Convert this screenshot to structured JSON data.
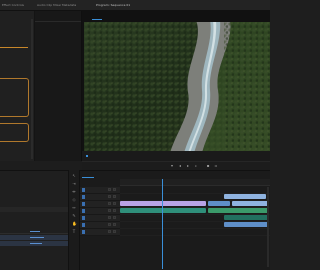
{
  "menubar": {
    "tabs": [
      "Effect Controls",
      "Audio Clip Mixer",
      "Metadata",
      "Program: Sequence 01"
    ]
  },
  "effect_controls": {
    "title": "Effect Controls"
  },
  "source_monitor": {
    "title": "Audio Clip Mixer"
  },
  "program_monitor": {
    "title": "Program: Sequence 01",
    "timecode": "00:00:05:00"
  },
  "transport": {
    "controls": [
      "marker-icon",
      "step-back-icon",
      "play-icon",
      "step-forward-icon",
      "insert-icon",
      "export-frame-icon"
    ]
  },
  "project_panel": {
    "title": "Project: Untitled",
    "columns": [
      "Name",
      "Frame Rate",
      "Media Start",
      "Media End"
    ],
    "rows": [
      {
        "name": "Clip 01",
        "selected": false
      },
      {
        "name": "Clip 02",
        "selected": true
      },
      {
        "name": "Clip 03",
        "selected": true
      },
      {
        "name": "Sequence 01",
        "selected": false
      }
    ]
  },
  "tools": {
    "items": [
      "selection-tool-icon",
      "track-select-icon",
      "ripple-edit-icon",
      "razor-tool-icon",
      "slip-tool-icon",
      "pen-tool-icon",
      "hand-tool-icon",
      "type-tool-icon"
    ]
  },
  "timeline": {
    "sequence_title": "Sequence 01",
    "ruler_ticks": [
      "00:00",
      "00:00:05:00",
      "00:00:10:00",
      "00:00:15:00",
      "00:00:20:00"
    ],
    "tracks": [
      "V3",
      "V2",
      "V1",
      "A1",
      "A2",
      "A3",
      "A4"
    ]
  },
  "colors": {
    "accent": "#3a8fd8",
    "panel_highlight": "#c8872a",
    "clip_video": "#b9a3e6",
    "clip_audio": "#3b9a6a"
  }
}
